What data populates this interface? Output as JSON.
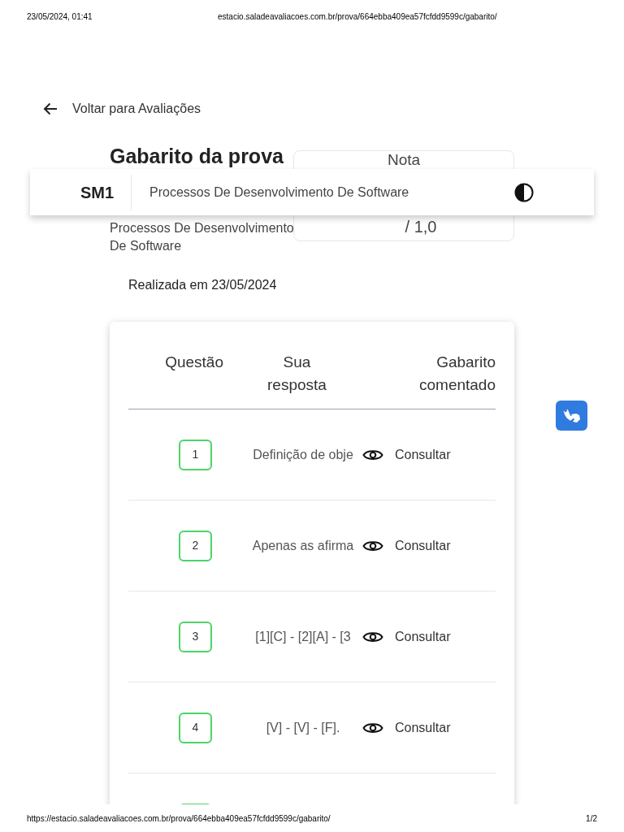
{
  "print_header": {
    "date": "23/05/2024, 01:41",
    "url": "estacio.saladeavaliacoes.com.br/prova/664ebba409ea57fcfdd9599c/gabarito/"
  },
  "back_link": "Voltar para Avaliações",
  "title": "Gabarito da prova",
  "subtitle": "Processos De Desenvolvimento De Software",
  "grade": {
    "label": "Nota",
    "max": "/ 1,0"
  },
  "top_bar": {
    "code": "SM1",
    "course": "Processos De Desenvolvimento De Software"
  },
  "date_taken": "Realizada em 23/05/2024",
  "table": {
    "columns": [
      "Questão",
      "Sua resposta",
      "Gabarito comentado"
    ],
    "rows": [
      {
        "number": "1",
        "answer": "Definição de obje",
        "action": "Consultar"
      },
      {
        "number": "2",
        "answer": "Apenas as afirma",
        "action": "Consultar"
      },
      {
        "number": "3",
        "answer": "[1][C] - [2][A] - [3",
        "action": "Consultar"
      },
      {
        "number": "4",
        "answer": "[V] - [V] - [F].",
        "action": "Consultar"
      }
    ],
    "more_below": true
  },
  "print_footer": {
    "url": "https://estacio.saladeavaliacoes.com.br/prova/664ebba409ea57fcfdd9599c/gabarito/",
    "page": "1/2"
  }
}
